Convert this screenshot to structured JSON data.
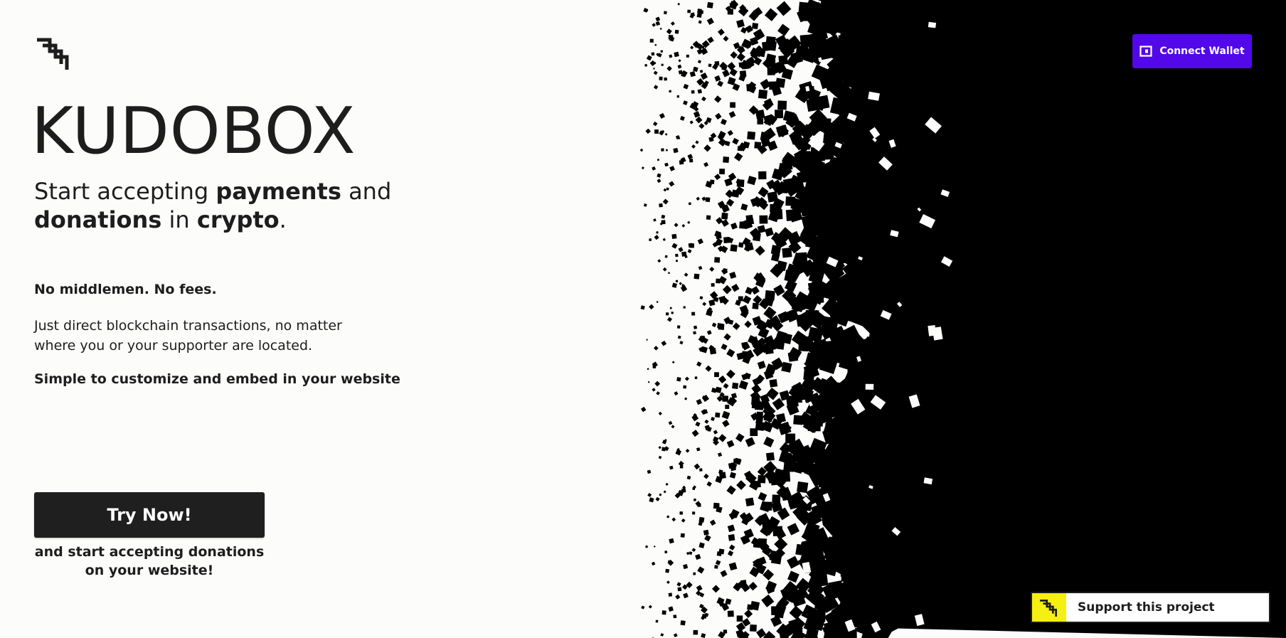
{
  "brand": {
    "logo_icon": "stacked-chevrons-icon",
    "name": "KUDOBOX"
  },
  "hero": {
    "tagline_1": "Start accepting ",
    "tagline_bold_1": "payments",
    "tagline_2": " and",
    "tagline_bold_2": "donations",
    "tagline_3": " in ",
    "tagline_bold_3": "crypto",
    "tagline_4": "."
  },
  "features": {
    "headline": "No middlemen. No fees.",
    "description": "Just direct blockchain transactions, no matter where you or your supporter are located.",
    "embed_note": "Simple to customize and embed in your website"
  },
  "cta": {
    "button_label": "Try Now!",
    "subtext": "and start accepting donations on your website!"
  },
  "header": {
    "connect_wallet_label": "Connect Wallet",
    "wallet_icon": "wallet-icon"
  },
  "support_widget": {
    "label": "Support this project",
    "logo_icon": "stacked-chevrons-icon"
  },
  "colors": {
    "accent": "#5208e8",
    "support_yellow": "#f6ef12",
    "dark": "#1f1f1f",
    "background": "#fcfcfb"
  }
}
